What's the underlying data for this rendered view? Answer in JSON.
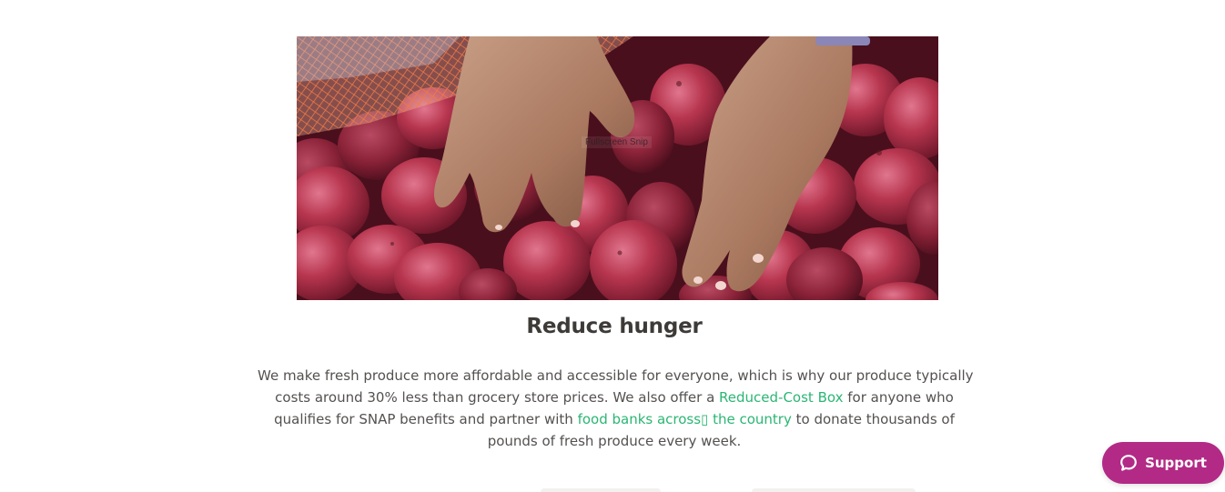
{
  "hero": {
    "overlay_label": "Fullscreen Snip"
  },
  "section": {
    "title": "Reduce hunger",
    "body_line1": "We make fresh produce more affordable and accessible for everyone, which is why our produce typically",
    "body_line2_a": "costs around 30% less than grocery store prices. We also offer a ",
    "link_reduced_cost": "Reduced-Cost Box",
    "body_line2_b": " for anyone who",
    "body_line3_a": "qualifies for SNAP benefits and partner with ",
    "link_food_banks": "food banks across▯ the country",
    "body_line3_b": " to donate thousands of",
    "body_line4": "pounds of fresh produce every week."
  },
  "support": {
    "label": "Support",
    "icon": "chat-bubble-icon"
  },
  "colors": {
    "link": "#2bb673",
    "support_bg": "#b22a86",
    "heading": "#3d3a38",
    "body_text": "#545150"
  }
}
